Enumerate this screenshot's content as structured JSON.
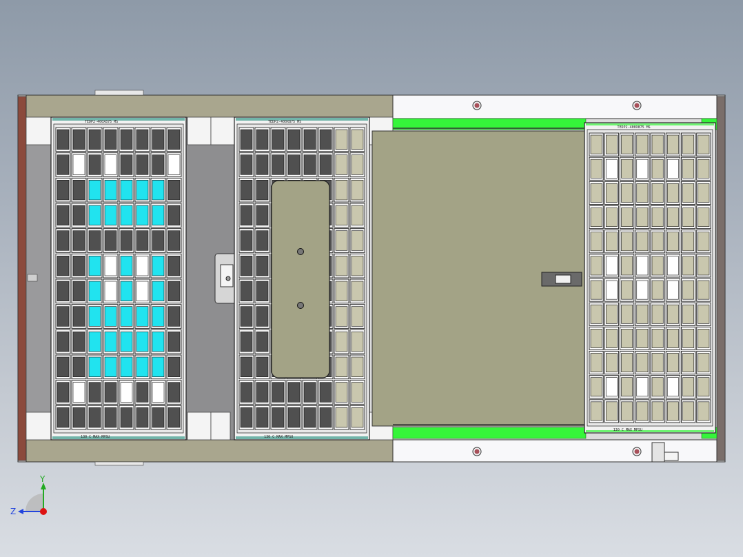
{
  "trays": [
    {
      "id": "left",
      "top_label": "TEDP2-400X875",
      "top_code": "MS",
      "bottom_temp": "130 C",
      "bottom_max": "MAX",
      "bottom_pressure": "MPSU",
      "cols": 8,
      "rows": 12,
      "highlight": "cyan"
    },
    {
      "id": "middle",
      "top_label": "TEDP2-400X875",
      "top_code": "MS",
      "bottom_temp": "130 C",
      "bottom_max": "MAX",
      "bottom_pressure": "MPSU",
      "cols": 8,
      "rows": 12,
      "highlight": "none"
    },
    {
      "id": "right",
      "top_label": "TEDP2-400X875",
      "top_code": "MS",
      "bottom_temp": "130 C",
      "bottom_max": "MAX",
      "bottom_pressure": "MPSU",
      "cols": 8,
      "rows": 12,
      "highlight": "none"
    }
  ],
  "triad": {
    "y_label": "Y",
    "z_label": "Z"
  },
  "colors": {
    "frame_khaki": "#a9a68e",
    "plate_khaki": "#a3a386",
    "rail_brown": "#8b4a3c",
    "rail_green": "#35f53a",
    "cyan_cell": "#21e3ef",
    "cell_dark": "#505050",
    "y_axis": "#22aa22",
    "z_axis": "#2244dd",
    "x_origin": "#dd1111"
  }
}
